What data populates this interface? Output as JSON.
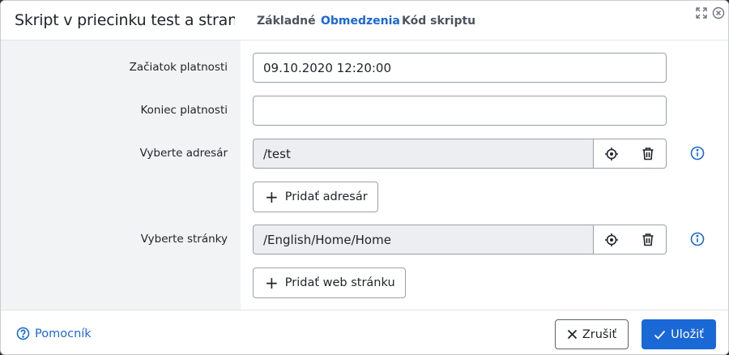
{
  "header": {
    "title": "Skript v priecinku test a stran...",
    "tabs": [
      {
        "label": "Základné",
        "active": false
      },
      {
        "label": "Obmedzenia",
        "active": true
      },
      {
        "label": "Kód skriptu",
        "active": false
      }
    ]
  },
  "form": {
    "start": {
      "label": "Začiatok platnosti",
      "value": "09.10.2020 12:20:00"
    },
    "end": {
      "label": "Koniec platnosti",
      "value": ""
    },
    "directory": {
      "label": "Vyberte adresár",
      "value": "/test",
      "add_label": "Pridať adresár"
    },
    "pages": {
      "label": "Vyberte stránky",
      "value": "/English/Home/Home",
      "add_label": "Pridať web stránku"
    }
  },
  "icons": {
    "maximize": "maximize-icon",
    "close": "close-icon",
    "select": "crosshair-icon",
    "delete": "trash-icon",
    "info": "info-icon",
    "help": "question-circle-icon"
  },
  "footer": {
    "help_label": "Pomocník",
    "cancel_label": "Zrušiť",
    "save_label": "Uložiť"
  },
  "colors": {
    "accent": "#1a68d6",
    "text": "#1f2329",
    "readonly_bg": "#eceef1"
  }
}
